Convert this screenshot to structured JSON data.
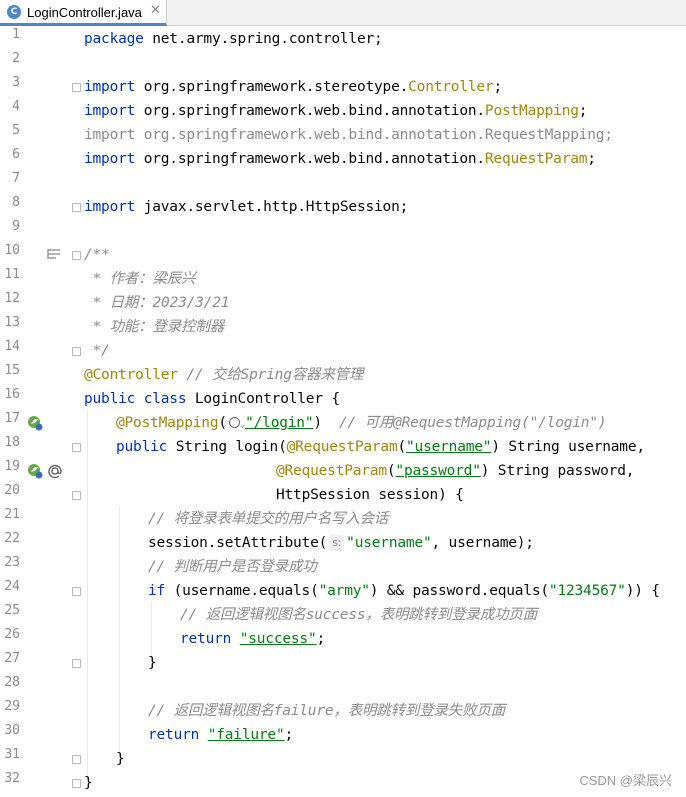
{
  "tab": {
    "icon": "C",
    "title": "LoginController.java",
    "close": "✕"
  },
  "lines": [
    {
      "n": "1"
    },
    {
      "n": "2"
    },
    {
      "n": "3"
    },
    {
      "n": "4"
    },
    {
      "n": "5"
    },
    {
      "n": "6"
    },
    {
      "n": "7"
    },
    {
      "n": "8"
    },
    {
      "n": "9"
    },
    {
      "n": "10"
    },
    {
      "n": "11"
    },
    {
      "n": "12"
    },
    {
      "n": "13"
    },
    {
      "n": "14"
    },
    {
      "n": "15"
    },
    {
      "n": "16"
    },
    {
      "n": "17"
    },
    {
      "n": "18"
    },
    {
      "n": "19"
    },
    {
      "n": "20"
    },
    {
      "n": "21"
    },
    {
      "n": "22"
    },
    {
      "n": "23"
    },
    {
      "n": "24"
    },
    {
      "n": "25"
    },
    {
      "n": "26"
    },
    {
      "n": "27"
    },
    {
      "n": "28"
    },
    {
      "n": "29"
    },
    {
      "n": "30"
    },
    {
      "n": "31"
    },
    {
      "n": "32"
    }
  ],
  "code": {
    "l1": {
      "kw": "package",
      "rest": " net.army.spring.controller;"
    },
    "l3": {
      "kw": "import",
      "pkg": " org.springframework.stereotype.",
      "cls": "Controller",
      "end": ";"
    },
    "l4": {
      "kw": "import",
      "pkg": " org.springframework.web.bind.annotation.",
      "cls": "PostMapping",
      "end": ";"
    },
    "l5": {
      "text": "import org.springframework.web.bind.annotation.RequestMapping;"
    },
    "l6": {
      "kw": "import",
      "pkg": " org.springframework.web.bind.annotation.",
      "cls": "RequestParam",
      "end": ";"
    },
    "l8": {
      "kw": "import",
      "rest": " javax.servlet.http.HttpSession;"
    },
    "l10": {
      "text": "/**"
    },
    "l11": {
      "text": " * 作者：梁辰兴"
    },
    "l12": {
      "text": " * 日期：2023/3/21"
    },
    "l13": {
      "text": " * 功能：登录控制器"
    },
    "l14": {
      "text": " */"
    },
    "l15": {
      "ann": "@Controller",
      "cmt": " // 交给Spring容器来管理"
    },
    "l16": {
      "kw1": "public",
      "kw2": " class",
      "rest": " LoginController {"
    },
    "l17": {
      "ann": "@PostMapping",
      "p1": "(",
      "str": "\"/login\"",
      "p2": ")",
      "cmt": "  // 可用@RequestMapping(\"/login\")"
    },
    "l18": {
      "kw": "public",
      "rest": " String login(",
      "ann": "@RequestParam",
      "p1": "(",
      "str": "\"username\"",
      "end": ") String username,"
    },
    "l19": {
      "ann": "@RequestParam",
      "p1": "(",
      "str": "\"password\"",
      "end": ") String password,"
    },
    "l20": {
      "text": "HttpSession session) {"
    },
    "l21": {
      "cmt": "// 将登录表单提交的用户名写入会话"
    },
    "l22": {
      "pre": "session.setAttribute(",
      "hint": "s:",
      "str": "\"username\"",
      "end": ", username);"
    },
    "l23": {
      "cmt": "// 判断用户是否登录成功"
    },
    "l24": {
      "kw": "if",
      "p1": " (username.equals(",
      "s1": "\"army\"",
      "p2": ") && password.equals(",
      "s2": "\"1234567\"",
      "end": ")) {"
    },
    "l25": {
      "cmt": "// 返回逻辑视图名success，表明跳转到登录成功页面"
    },
    "l26": {
      "kw": "return",
      "str": "\"success\"",
      "end": ";"
    },
    "l27": {
      "text": "}"
    },
    "l29": {
      "cmt": "// 返回逻辑视图名failure，表明跳转到登录失败页面"
    },
    "l30": {
      "kw": "return",
      "str": "\"failure\"",
      "end": ";"
    },
    "l31": {
      "text": "}"
    },
    "l32": {
      "text": "}"
    }
  },
  "watermark": "CSDN @梁辰兴",
  "colors": {
    "keyword": "#0033b3",
    "annotation": "#9e880d",
    "string": "#067d17",
    "comment": "#8c8c8c",
    "tab_accent": "#4a88c7"
  },
  "icons": [
    "java-class-icon",
    "close-icon",
    "fold-marker-icon",
    "spring-bean-icon",
    "mapping-icon",
    "doc-render-icon",
    "web-url-icon"
  ]
}
